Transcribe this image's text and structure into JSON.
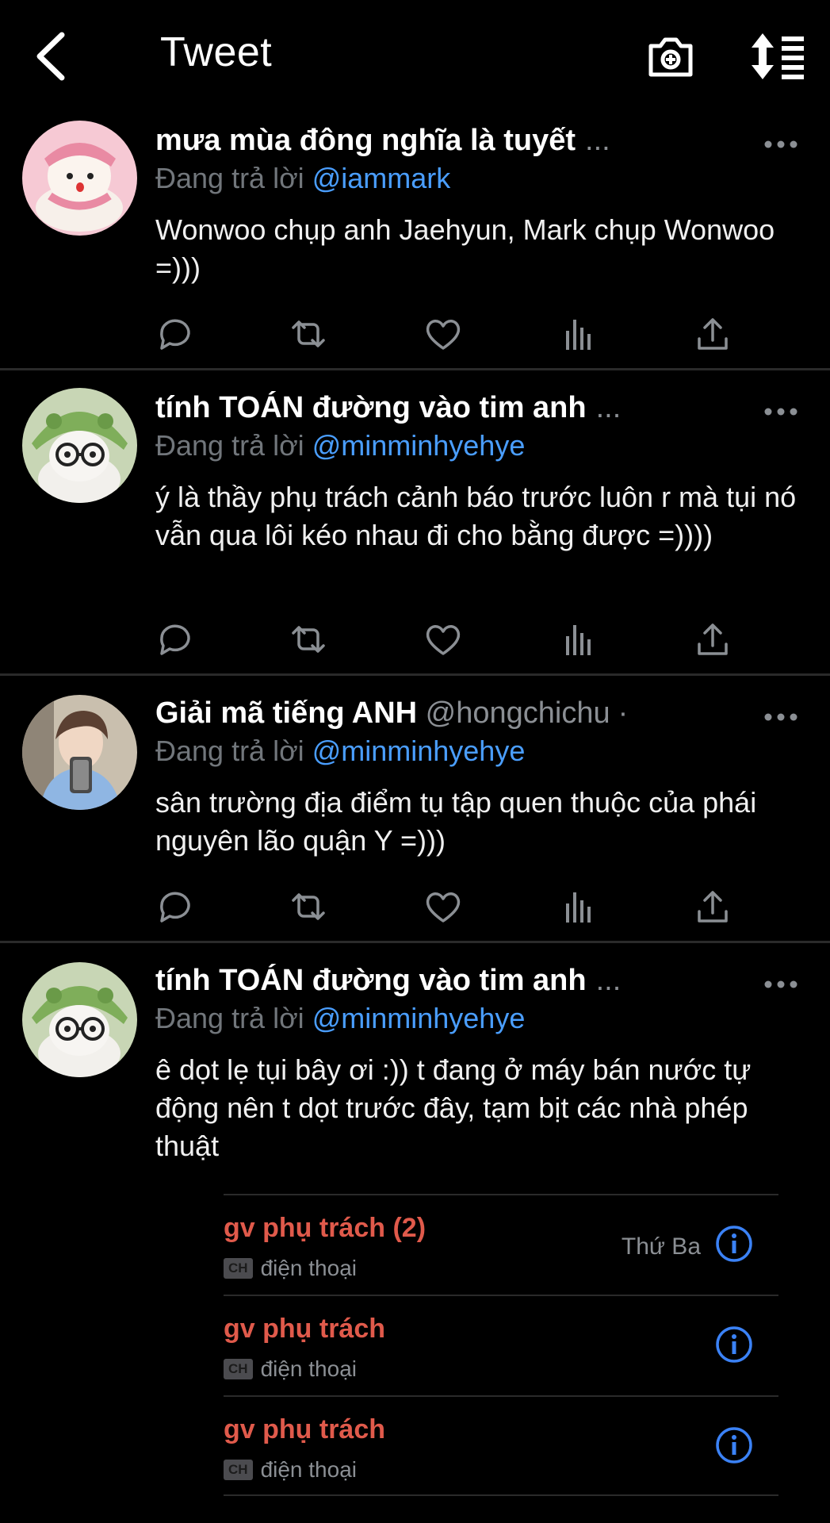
{
  "header": {
    "title": "Tweet"
  },
  "tweets": [
    {
      "display_name": "mưa mùa đông nghĩa là tuyết",
      "name_ellipsis": "...",
      "handle_inline": "",
      "reply_prefix": "Đang trả lời",
      "reply_handle": "@iammark",
      "body": "Wonwoo chụp anh Jaehyun, Mark chụp Wonwoo =)))"
    },
    {
      "display_name": "tính TOÁN đường vào tim anh",
      "name_ellipsis": "...",
      "handle_inline": "",
      "reply_prefix": "Đang trả lời",
      "reply_handle": "@minminhyehye",
      "body": "ý là thầy phụ trách cảnh báo trước luôn r mà tụi nó vẫn qua lôi kéo nhau đi cho bằng được =))))"
    },
    {
      "display_name": "Giải mã tiếng ANH",
      "name_ellipsis": "·",
      "handle_inline": "@hongchichu",
      "reply_prefix": "Đang trả lời",
      "reply_handle": "@minminhyehye",
      "body": "sân trường địa điểm tụ tập quen thuộc của phái nguyên lão quận Y =)))"
    },
    {
      "display_name": "tính TOÁN đường vào tim anh",
      "name_ellipsis": "...",
      "handle_inline": "",
      "reply_prefix": "Đang trả lời",
      "reply_handle": "@minminhyehye",
      "body": "ê dọt lẹ tụi bây ơi :)) t đang ở máy bán nước tự động nên t dọt trước đây, tạm bịt các nhà phép thuật"
    }
  ],
  "contacts": [
    {
      "name": "gv phụ trách (2)",
      "badge": "CH",
      "type": "điện thoại",
      "date": "Thứ Ba"
    },
    {
      "name": "gv phụ trách",
      "badge": "CH",
      "type": "điện thoại",
      "date": ""
    },
    {
      "name": "gv phụ trách",
      "badge": "CH",
      "type": "điện thoại",
      "date": ""
    }
  ],
  "colors": {
    "background": "#000000",
    "link": "#4a9eff",
    "muted": "#71767b",
    "contact_name": "#e05a4b",
    "info_icon": "#3b82f6"
  }
}
